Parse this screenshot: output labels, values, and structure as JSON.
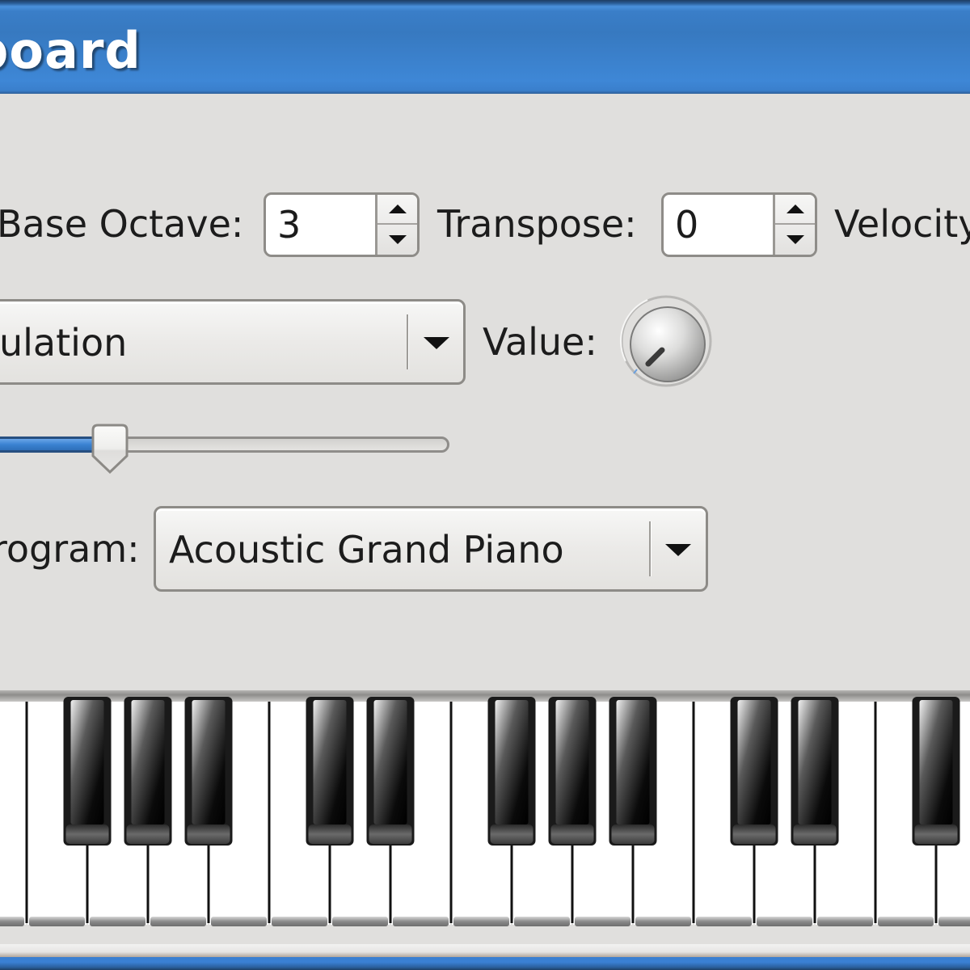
{
  "window": {
    "title_partial": "board",
    "title_bar_color": "#3a7fcc"
  },
  "controls": {
    "base_octave": {
      "label": "Base Octave:",
      "value": "3"
    },
    "transpose": {
      "label": "Transpose:",
      "value": "0"
    },
    "velocity": {
      "label": "Velocity"
    },
    "controller_combo": {
      "value_partial": "ulation"
    },
    "value_knob": {
      "label": "Value:",
      "level_fraction": 0.0
    },
    "slider": {
      "fill_fraction": 0.27,
      "fill_color": "#3a82d2"
    },
    "program": {
      "label_partial": "rogram:",
      "value": "Acoustic Grand Piano"
    }
  },
  "keyboard": {
    "white_key_count": 17,
    "black_keys_after_white_index": [
      1,
      2,
      3,
      5,
      6,
      8,
      9,
      10,
      12,
      13,
      15
    ],
    "pressed_keys": []
  },
  "icons": {
    "spin_up": "triangle-up",
    "spin_down": "triangle-down",
    "combo_arrow": "triangle-down",
    "knob": "rotary-knob"
  }
}
